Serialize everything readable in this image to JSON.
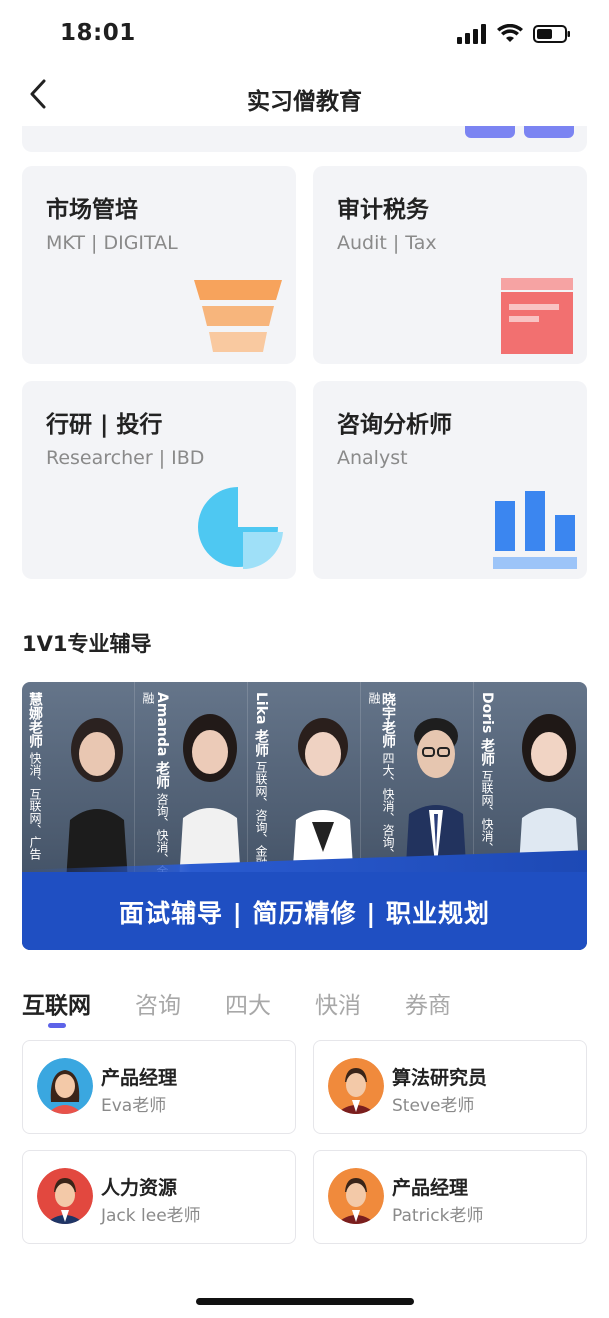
{
  "status_bar": {
    "time": "18:01",
    "icons": [
      "signal-icon",
      "wifi-icon",
      "battery-icon"
    ]
  },
  "nav": {
    "title": "实习僧教育",
    "back_icon": "chevron-left-icon"
  },
  "categories": [
    {
      "title": "市场管培",
      "subtitle": "MKT | DIGITAL",
      "icon": "funnel-icon",
      "color": "#f5a05a"
    },
    {
      "title": "审计税务",
      "subtitle": "Audit | Tax",
      "icon": "document-icon",
      "color": "#f26e6e"
    },
    {
      "title": "行研 | 投行",
      "subtitle": "Researcher | IBD",
      "icon": "pie-chart-icon",
      "color": "#4fc6f0"
    },
    {
      "title": "咨询分析师",
      "subtitle": "Analyst",
      "icon": "bar-chart-icon",
      "color": "#3f86f0"
    }
  ],
  "coaching": {
    "section_title": "1V1专业辅导",
    "banner": {
      "teachers": [
        {
          "name": "慧娜老师",
          "tags": "快消、互联网、广告"
        },
        {
          "name": "Amanda 老师",
          "tags": "咨询、快消、金融"
        },
        {
          "name": "Lika 老师",
          "tags": "互联网、咨询、金融"
        },
        {
          "name": "晓宇老师",
          "tags": "四大、快消、咨询、金融"
        },
        {
          "name": "Doris 老师",
          "tags": "互联网、快消、银行"
        }
      ],
      "slogan": "面试辅导 | 简历精修 | 职业规划"
    }
  },
  "tabs": {
    "items": [
      "互联网",
      "咨询",
      "四大",
      "快消",
      "券商"
    ],
    "active_index": 0,
    "accent": "#5d63e8"
  },
  "mentors": [
    {
      "role": "产品经理",
      "name": "Eva老师",
      "avatar": "female-avatar-icon",
      "bg": "#3aa7e0"
    },
    {
      "role": "算法研究员",
      "name": "Steve老师",
      "avatar": "male-avatar-icon",
      "bg": "#f08a3c"
    },
    {
      "role": "人力资源",
      "name": "Jack lee老师",
      "avatar": "male-avatar-icon",
      "bg": "#e2483f"
    },
    {
      "role": "产品经理",
      "name": "Patrick老师",
      "avatar": "male-avatar-icon",
      "bg": "#f08a3c"
    }
  ]
}
